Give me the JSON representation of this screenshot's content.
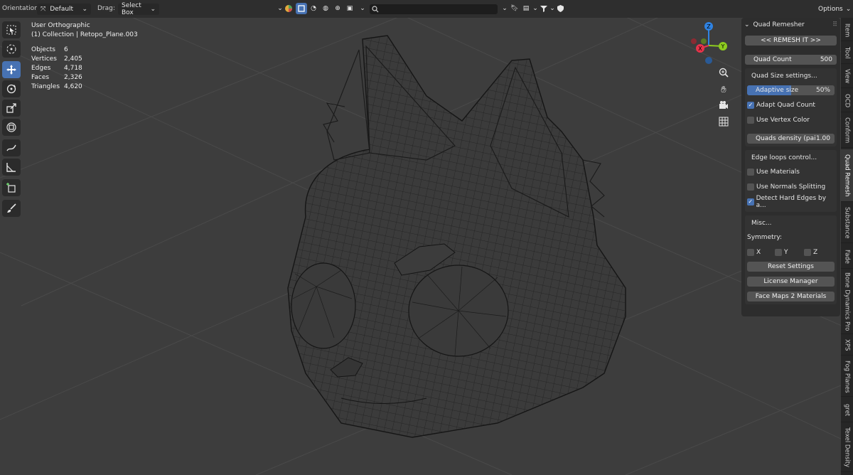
{
  "header": {
    "orientation_label": "Orientation:",
    "orientation_value": "Default",
    "drag_label": "Drag:",
    "drag_value": "Select Box",
    "search_placeholder": "",
    "options_label": "Options"
  },
  "overlay": {
    "view_name": "User Orthographic",
    "collection": "(1) Collection | Retopo_Plane.003"
  },
  "stats": [
    {
      "key": "Objects",
      "value": "6"
    },
    {
      "key": "Vertices",
      "value": "2,405"
    },
    {
      "key": "Edges",
      "value": "4,718"
    },
    {
      "key": "Faces",
      "value": "2,326"
    },
    {
      "key": "Triangles",
      "value": "4,620"
    }
  ],
  "gizmo": {
    "z": "Z",
    "x": "X",
    "y": "Y",
    "colors": {
      "x": "#e8334a",
      "y": "#8ecc1f",
      "z": "#2f83e3"
    }
  },
  "panel": {
    "title": "Quad Remesher",
    "remesh_button": "<< REMESH IT >>",
    "quad_count_label": "Quad Count",
    "quad_count_value": "500",
    "size_section": "Quad Size settings...",
    "adaptive_label": "Adaptive size",
    "adaptive_value": "50%",
    "adaptive_fraction": 0.5,
    "adapt_quad_count": "Adapt Quad Count",
    "use_vertex_color": "Use Vertex Color",
    "quads_density_label": "Quads density (pai",
    "quads_density_value": "1.00",
    "edge_section": "Edge loops control...",
    "use_materials": "Use Materials",
    "use_normals": "Use Normals Splitting",
    "detect_hard": "Detect Hard Edges by a...",
    "misc_section": "Misc...",
    "symmetry_label": "Symmetry:",
    "sym_x": "X",
    "sym_y": "Y",
    "sym_z": "Z",
    "reset_button": "Reset Settings",
    "license_button": "License Manager",
    "facemaps_button": "Face Maps 2 Materials"
  },
  "tabs": [
    "Item",
    "Tool",
    "View",
    "OCD",
    "Conform",
    "Quad Remesh",
    "Substance",
    "Fade",
    "Bone Dynamics Pro",
    "XPS",
    "Fog Planes",
    "gret",
    "Texel Density"
  ],
  "accent": "#4772b3"
}
